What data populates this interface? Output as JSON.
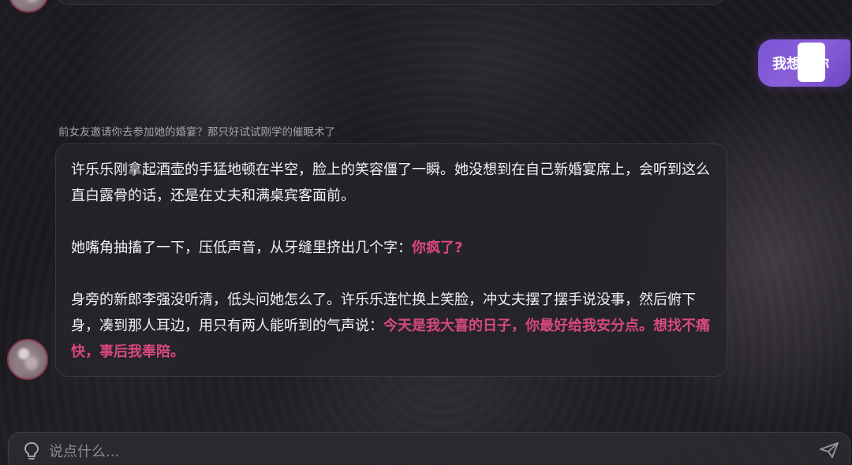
{
  "chat": {
    "scenario_caption": "前女友邀请你去参加她的婚宴？那只好试试刚学的催眠术了",
    "user_message": "我想　你",
    "ai_message": {
      "p1": "许乐乐刚拿起酒壶的手猛地顿在半空，脸上的笑容僵了一瞬。她没想到在自己新婚宴席上，会听到这么直白露骨的话，还是在丈夫和满桌宾客面前。",
      "p2_text": "她嘴角抽搐了一下，压低声音，从牙缝里挤出几个字：",
      "p2_highlight": "你疯了?",
      "p3_text": "身旁的新郎李强没听清，低头问她怎么了。许乐乐连忙换上笑脸，冲丈夫摆了摆手说没事，然后俯下身，凑到那人耳边，用只有两人能听到的气声说：",
      "p3_highlight": "今天是我大喜的日子，你最好给我安分点。想找不痛快，事后我奉陪。"
    }
  },
  "input": {
    "placeholder": "说点什么..."
  },
  "icons": {
    "input_left": "lightbulb-icon",
    "send": "send-icon"
  },
  "colors": {
    "highlight": "#d8497c",
    "user_bubble": "#7a55d6",
    "avatar_border": "#8a3a52"
  }
}
